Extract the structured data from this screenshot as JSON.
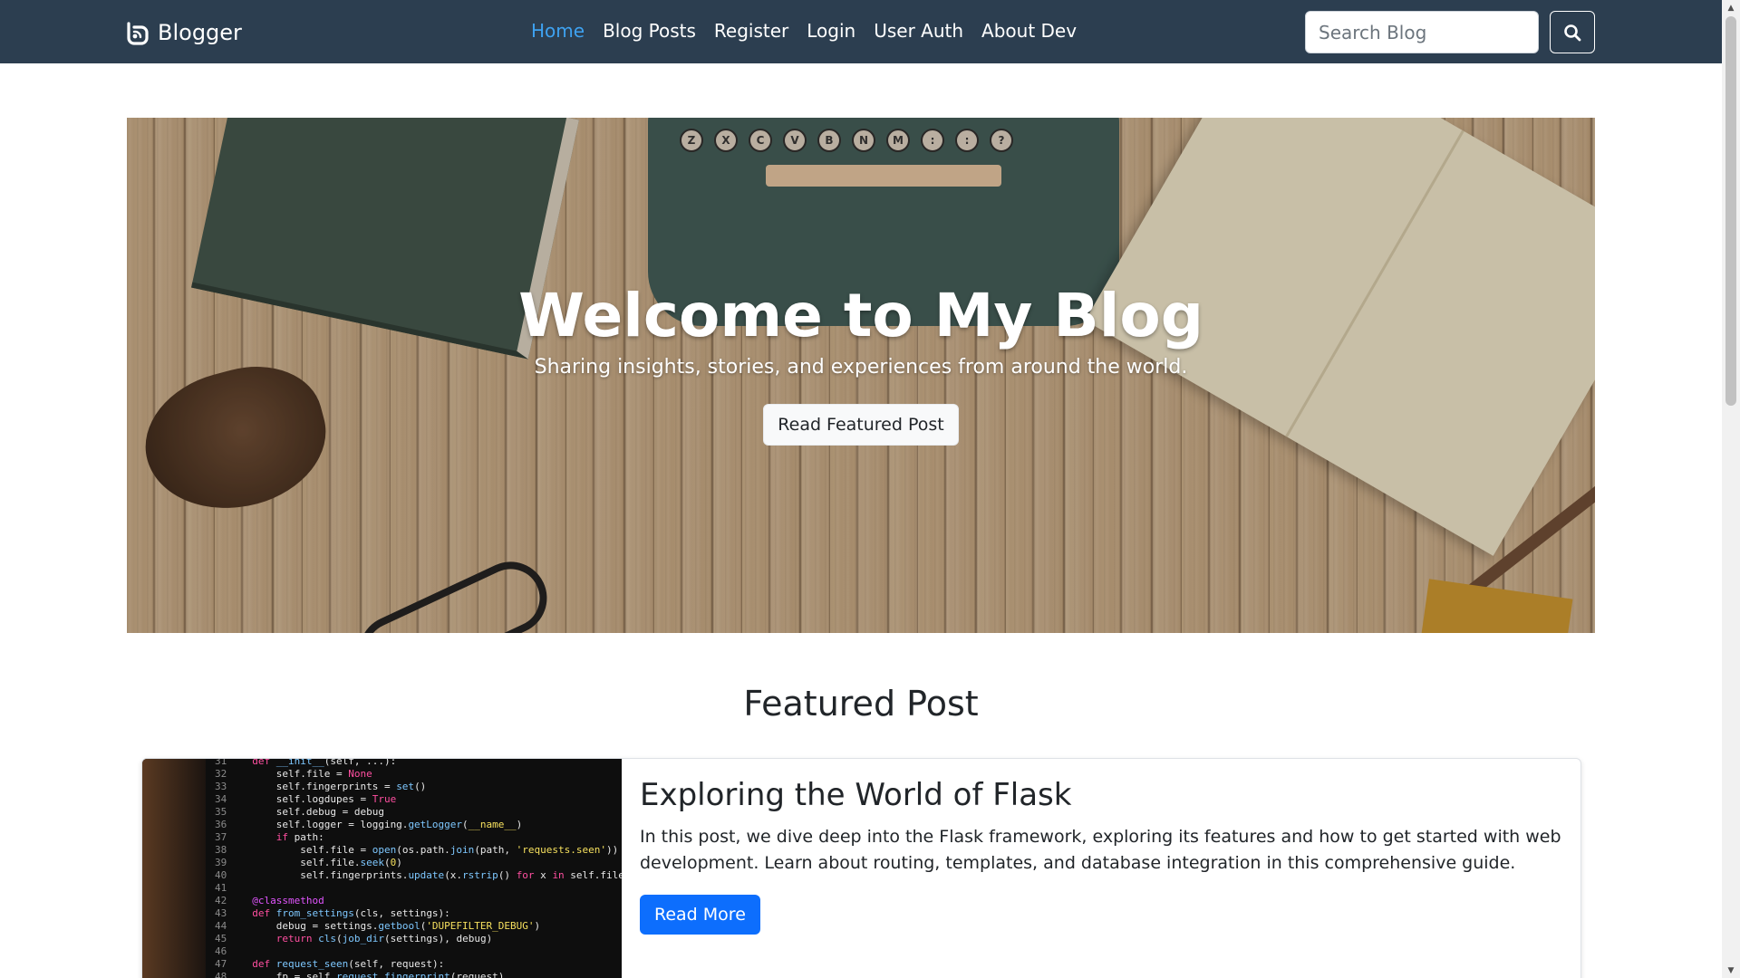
{
  "navbar": {
    "brand": "Blogger",
    "brand_icon": "blogger-icon",
    "links": [
      {
        "label": "Home",
        "active": true
      },
      {
        "label": "Blog Posts",
        "active": false
      },
      {
        "label": "Register",
        "active": false
      },
      {
        "label": "Login",
        "active": false
      },
      {
        "label": "User Auth",
        "active": false
      },
      {
        "label": "About Dev",
        "active": false
      }
    ],
    "search_placeholder": "Search Blog",
    "search_icon": "search-icon"
  },
  "hero": {
    "title": "Welcome to My Blog",
    "subtitle": "Sharing insights, stories, and experiences from around the world.",
    "button_label": "Read Featured Post",
    "keys": [
      "Z",
      "X",
      "C",
      "V",
      "B",
      "N",
      "M",
      ":",
      ":",
      "?"
    ]
  },
  "featured": {
    "heading": "Featured Post",
    "post": {
      "title": "Exploring the World of Flask",
      "text": "In this post, we dive deep into the Flask framework, exploring its features and how to get started with web development. Learn about routing, templates, and database integration in this comprehensive guide.",
      "button_label": "Read More"
    }
  },
  "colors": {
    "navbar_bg": "#2c3e50",
    "active_link": "#3ea2f1",
    "primary": "#0d6efd"
  }
}
